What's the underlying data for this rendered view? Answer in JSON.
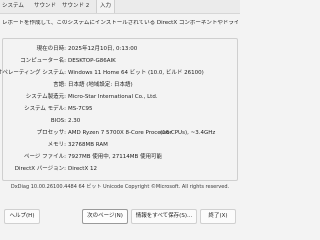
{
  "tabs": [
    {
      "label": "システム",
      "active": false
    },
    {
      "label": "サウンド",
      "active": false
    },
    {
      "label": "サウンド 2",
      "active": false
    },
    {
      "label": "入力",
      "active": true
    }
  ],
  "intro": "レポートを作成して、このシステムにインストールされている DirectX コンポーネントやドライバーの詳細情報をまとめることができます。",
  "system_info": [
    {
      "label": "現在の日時:",
      "value": "2025年12月10日, 0:13:00",
      "extra": ""
    },
    {
      "label": "コンピューター名:",
      "value": "DESKTOP-G86AIK",
      "extra": ""
    },
    {
      "label": "オペレーティング システム:",
      "value": "Windows 11 Home 64 ビット (10.0, ビルド 26100)",
      "extra": ""
    },
    {
      "label": "言語:",
      "value": "日本語 (地域設定: 日本語)",
      "extra": ""
    },
    {
      "label": "システム製造元:",
      "value": "Micro-Star International Co., Ltd.",
      "extra": ""
    },
    {
      "label": "システム モデル:",
      "value": "MS-7C95",
      "extra": ""
    },
    {
      "label": "BIOS:",
      "value": "2.30",
      "extra": ""
    },
    {
      "label": "プロセッサ:",
      "value": "AMD Ryzen 7 5700X 8-Core Processor",
      "extra": "(16 CPUs), ~3.4GHz"
    },
    {
      "label": "メモリ:",
      "value": "32768MB RAM",
      "extra": ""
    },
    {
      "label": "ページ ファイル:",
      "value": "7927MB 使用中, 27114MB 使用可能",
      "extra": ""
    },
    {
      "label": "DirectX バージョン:",
      "value": "DirectX 12",
      "extra": ""
    }
  ],
  "footer": "DxDiag 10.00.26100.4484 64 ビット Unicode Copyright ©Microsoft. All rights reserved.",
  "buttons": {
    "help": "ヘルプ(H)",
    "next": "次のページ(N)",
    "save": "情報をすべて保存(S)...",
    "exit": "終了(X)"
  }
}
